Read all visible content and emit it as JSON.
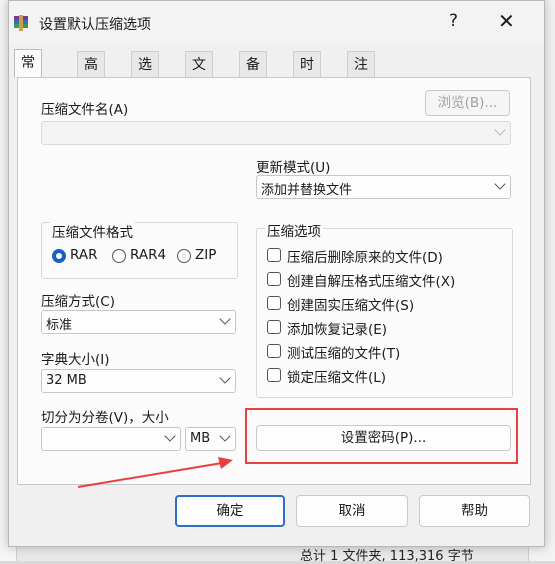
{
  "dialog": {
    "title": "设置默认压缩选项",
    "help_glyph": "?",
    "close_glyph": "✕"
  },
  "tabs": [
    "常规",
    "高级",
    "选项",
    "文件",
    "备份",
    "时间",
    "注释"
  ],
  "general": {
    "archive_name_label": "压缩文件名(A)",
    "browse_label": "浏览(B)...",
    "archive_name_value": "",
    "update_mode_label": "更新模式(U)",
    "update_mode_value": "添加并替换文件",
    "format_group_label": "压缩文件格式",
    "format_options": [
      "RAR",
      "RAR4",
      "ZIP"
    ],
    "format_selected": "RAR",
    "method_label": "压缩方式(C)",
    "method_value": "标准",
    "dict_label": "字典大小(I)",
    "dict_value": "32 MB",
    "split_label": "切分为分卷(V)，大小",
    "split_value": "",
    "split_unit": "MB",
    "options_group_label": "压缩选项",
    "options": [
      {
        "label": "压缩后删除原来的文件(D)",
        "checked": false
      },
      {
        "label": "创建自解压格式压缩文件(X)",
        "checked": false
      },
      {
        "label": "创建固实压缩文件(S)",
        "checked": false
      },
      {
        "label": "添加恢复记录(E)",
        "checked": false
      },
      {
        "label": "测试压缩的文件(T)",
        "checked": false
      },
      {
        "label": "锁定压缩文件(L)",
        "checked": false
      }
    ],
    "set_password_label": "设置密码(P)..."
  },
  "footer": {
    "ok": "确定",
    "cancel": "取消",
    "help": "帮助"
  },
  "background": {
    "status_text": "总计 1 文件夹, 113,316 字节"
  },
  "colors": {
    "highlight": "#e8403e",
    "accent": "#1a5fc4"
  }
}
